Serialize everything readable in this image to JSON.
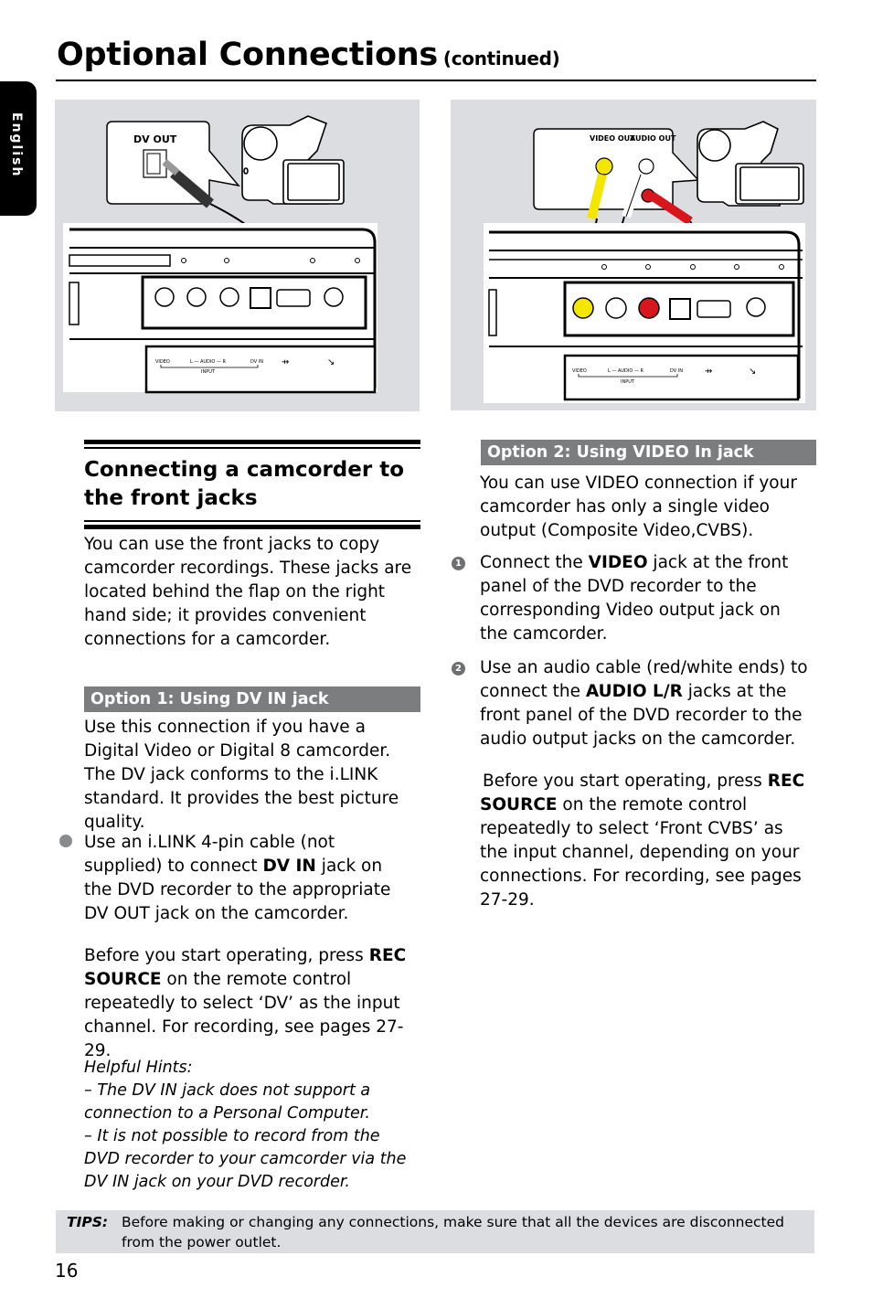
{
  "header": {
    "title": "Optional Connections",
    "subtitle": "(continued)",
    "language_tab": "English"
  },
  "figure1": {
    "camcorder_port_label": "DV OUT",
    "panel_labels": {
      "video": "VIDEO",
      "audio": "L — AUDIO — R",
      "dv_in": "DV IN",
      "input": "INPUT"
    }
  },
  "figure2": {
    "camcorder_port_labels": [
      "VIDEO OUT",
      "AUDIO OUT"
    ],
    "panel_labels": {
      "video": "VIDEO",
      "audio": "L — AUDIO — R",
      "dv_in": "DV IN",
      "input": "INPUT"
    },
    "cable_colors": {
      "video": "#f5e600",
      "audio_left": "#ffffff",
      "audio_right": "#d8161e"
    }
  },
  "section": {
    "heading": "Connecting a camcorder to the front jacks",
    "intro": "You can use the front jacks to copy camcorder recordings. These jacks are located behind the flap on the right hand side; it provides convenient connections for a camcorder."
  },
  "option1": {
    "title": "Option 1: Using DV IN jack",
    "description": "Use this connection if you have a Digital Video or Digital 8 camcorder. The DV jack conforms to the i.LINK standard. It provides the best picture quality.",
    "step": {
      "pre": "Use an i.LINK 4-pin cable (not supplied) to connect ",
      "bold": "DV IN",
      "post": " jack on the DVD recorder to the appropriate DV OUT jack on the camcorder."
    },
    "note": {
      "pre": "Before you start operating, press ",
      "bold": "REC SOURCE",
      "post": " on the remote control repeatedly to select ‘DV’ as the input channel. For recording, see pages 27-29."
    },
    "hints_title": "Helpful Hints:",
    "hints": [
      "– The DV IN jack does not support a connection to a Personal Computer.",
      "– It is not possible to record from the DVD recorder to your camcorder via the DV IN jack on your DVD recorder."
    ]
  },
  "option2": {
    "title": "Option 2: Using VIDEO In jack",
    "description": "You can use VIDEO connection if your camcorder has only a  single video output (Composite Video,CVBS).",
    "steps": [
      {
        "num": "1",
        "pre": "Connect the ",
        "bold": "VIDEO",
        "post": " jack at the front panel of the DVD recorder to the corresponding Video output jack on the camcorder."
      },
      {
        "num": "2",
        "pre": "Use an audio cable (red/white ends) to connect the ",
        "bold": "AUDIO L/R",
        "post": " jacks at the front panel of the DVD recorder to the audio output jacks on the camcorder."
      }
    ],
    "note": {
      "pre": "Before you start operating, press ",
      "bold": "REC SOURCE",
      "post": " on the remote control repeatedly to select ‘Front CVBS’ as the input channel, depending on your connections. For recording, see pages 27-29."
    }
  },
  "tips": {
    "label": "TIPS:",
    "text": "Before making or changing any connections, make sure that all the devices are disconnected from the power outlet."
  },
  "footer": {
    "page_number": "16"
  }
}
